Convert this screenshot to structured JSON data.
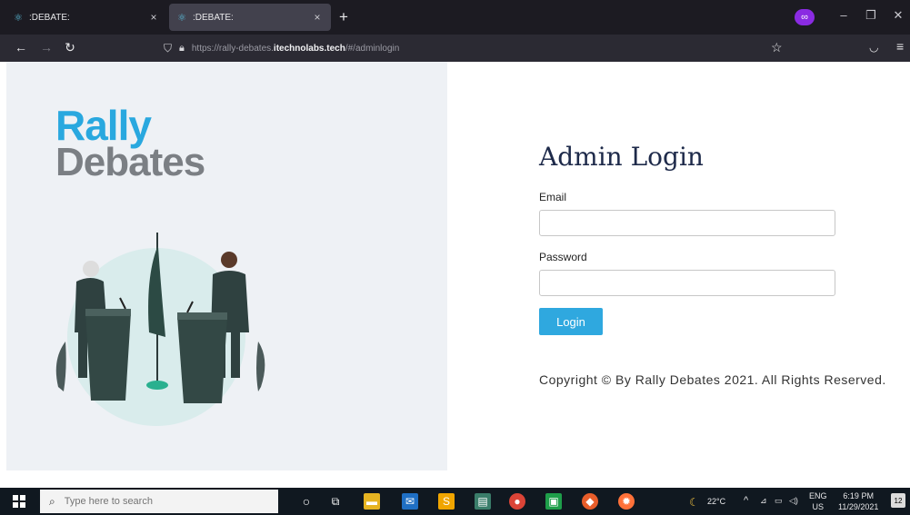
{
  "browser": {
    "tabs": [
      {
        "label": ":DEBATE:",
        "close": "×",
        "icon": "react-favicon-icon"
      },
      {
        "label": ":DEBATE:",
        "close": "×",
        "icon": "react-favicon-icon"
      }
    ],
    "new_tab": "+",
    "url_prefix": "https://rally-debates.",
    "url_domain": "itechnolabs.tech",
    "url_suffix": "/#/adminlogin"
  },
  "page": {
    "logo_line1": "Rally",
    "logo_line2": "Debates",
    "title": "Admin Login",
    "email_label": "Email",
    "email_value": "",
    "password_label": "Password",
    "password_value": "",
    "login_button": "Login",
    "copyright": "Copyright © By Rally Debates 2021. All Rights Reserved."
  },
  "taskbar": {
    "search_placeholder": "Type here to search",
    "temperature": "22°C",
    "lang1": "ENG",
    "lang2": "US",
    "time": "6:19 PM",
    "date": "11/29/2021",
    "notifications": "12"
  },
  "colors": {
    "brand_blue": "#29a8df",
    "brand_gray": "#7b7f84",
    "title_navy": "#1e2a4a",
    "button_blue": "#2fa8df"
  }
}
